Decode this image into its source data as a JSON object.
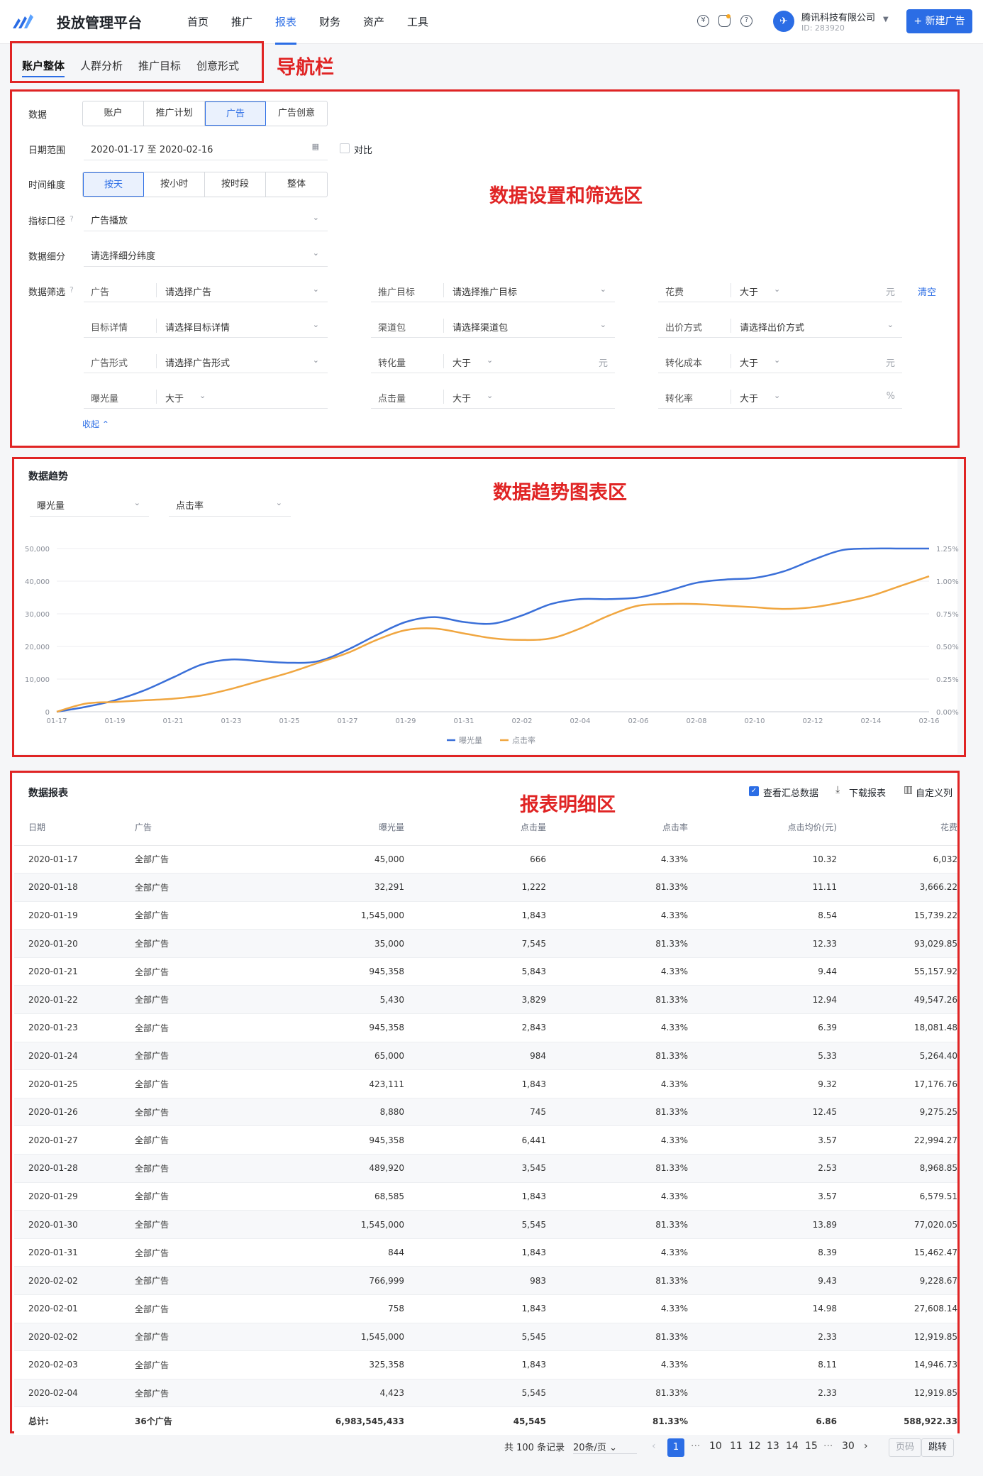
{
  "header": {
    "app_title": "投放管理平台",
    "nav": [
      "首页",
      "推广",
      "报表",
      "财务",
      "资产",
      "工具"
    ],
    "active_nav": "报表",
    "company": "腾讯科技有限公司",
    "company_id": "ID: 283920",
    "new_btn": "+ 新建广告"
  },
  "annotations": {
    "nav": "导航栏",
    "filter": "数据设置和筛选区",
    "chart": "数据趋势图表区",
    "table": "报表明细区"
  },
  "subnav": [
    "账户整体",
    "人群分析",
    "推广目标",
    "创意形式"
  ],
  "filters": {
    "data_label": "数据",
    "data_opts": [
      "账户",
      "推广计划",
      "广告",
      "广告创意"
    ],
    "date_label": "日期范围",
    "date_value": "2020-01-17 至 2020-02-16",
    "compare": "对比",
    "dim_label": "时间维度",
    "dim_opts": [
      "按天",
      "按小时",
      "按时段",
      "整体"
    ],
    "metric_label": "指标口径",
    "metric_value": "广告播放",
    "detail_label": "数据细分",
    "detail_value": "请选择细分纬度",
    "filter_label": "数据筛选",
    "clear": "清空",
    "collapse": "收起",
    "rows": [
      [
        {
          "k": "广告",
          "v": "请选择广告"
        },
        {
          "k": "推广目标",
          "v": "请选择推广目标"
        },
        {
          "k": "花费",
          "v": "大于",
          "u": "元"
        }
      ],
      [
        {
          "k": "目标详情",
          "v": "请选择目标详情"
        },
        {
          "k": "渠道包",
          "v": "请选择渠道包"
        },
        {
          "k": "出价方式",
          "v": "请选择出价方式"
        }
      ],
      [
        {
          "k": "广告形式",
          "v": "请选择广告形式"
        },
        {
          "k": "转化量",
          "v": "大于",
          "u": "元"
        },
        {
          "k": "转化成本",
          "v": "大于",
          "u": "元"
        }
      ],
      [
        {
          "k": "曝光量",
          "v": "大于"
        },
        {
          "k": "点击量",
          "v": "大于"
        },
        {
          "k": "转化率",
          "v": "大于",
          "u": "%"
        }
      ]
    ]
  },
  "trend": {
    "title": "数据趋势",
    "sel1": "曝光量",
    "sel2": "点击率"
  },
  "chart_data": {
    "type": "line",
    "x": [
      "01-17",
      "01-18",
      "01-19",
      "01-20",
      "01-21",
      "01-22",
      "01-23",
      "01-24",
      "01-25",
      "01-26",
      "01-27",
      "01-28",
      "01-29",
      "01-30",
      "01-31",
      "02-01",
      "02-02",
      "02-03",
      "02-04",
      "02-05",
      "02-06",
      "02-07",
      "02-08",
      "02-09",
      "02-10",
      "02-11",
      "02-12",
      "02-13",
      "02-14",
      "02-15",
      "02-16"
    ],
    "xticks": [
      "01-17",
      "01-19",
      "01-21",
      "01-23",
      "01-25",
      "01-27",
      "01-29",
      "01-31",
      "02-02",
      "02-04",
      "02-06",
      "02-08",
      "02-10",
      "02-12",
      "02-14",
      "02-16"
    ],
    "yleft_ticks": [
      "0",
      "10,000",
      "20,000",
      "30,000",
      "40,000",
      "50,000"
    ],
    "ylim_left": [
      0,
      50000
    ],
    "yright_ticks": [
      "0.00%",
      "0.25%",
      "0.50%",
      "0.75%",
      "1.00%",
      "1.25%"
    ],
    "ylim_right": [
      0,
      1.25
    ],
    "series": [
      {
        "name": "曝光量",
        "axis": "left",
        "color": "#3a6fd8",
        "values": [
          0,
          1500,
          3500,
          6500,
          10500,
          14500,
          16000,
          15500,
          15000,
          15500,
          19000,
          23500,
          27500,
          29000,
          27500,
          27000,
          29500,
          33000,
          34500,
          34500,
          35000,
          37000,
          39500,
          40500,
          41000,
          43000,
          46500,
          49500,
          50000,
          50000,
          50000
        ]
      },
      {
        "name": "点击率",
        "axis": "left",
        "color": "#f0a640",
        "values": [
          0,
          2500,
          3000,
          3500,
          4000,
          5000,
          7000,
          9500,
          12000,
          15000,
          18000,
          22000,
          25000,
          25500,
          24000,
          22500,
          22000,
          22500,
          25500,
          29500,
          32500,
          33000,
          33000,
          32500,
          32000,
          31500,
          32000,
          33500,
          35500,
          38500,
          41500
        ]
      }
    ]
  },
  "report": {
    "title": "数据报表",
    "summary": "查看汇总数据",
    "download": "下载报表",
    "custom": "自定义列",
    "columns": [
      "日期",
      "广告",
      "曝光量",
      "点击量",
      "点击率",
      "点击均价(元)",
      "花费"
    ],
    "rows": [
      [
        "2020-01-17",
        "全部广告",
        "45,000",
        "666",
        "4.33%",
        "10.32",
        "6,032"
      ],
      [
        "2020-01-18",
        "全部广告",
        "32,291",
        "1,222",
        "81.33%",
        "11.11",
        "3,666.22"
      ],
      [
        "2020-01-19",
        "全部广告",
        "1,545,000",
        "1,843",
        "4.33%",
        "8.54",
        "15,739.22"
      ],
      [
        "2020-01-20",
        "全部广告",
        "35,000",
        "7,545",
        "81.33%",
        "12.33",
        "93,029.85"
      ],
      [
        "2020-01-21",
        "全部广告",
        "945,358",
        "5,843",
        "4.33%",
        "9.44",
        "55,157.92"
      ],
      [
        "2020-01-22",
        "全部广告",
        "5,430",
        "3,829",
        "81.33%",
        "12.94",
        "49,547.26"
      ],
      [
        "2020-01-23",
        "全部广告",
        "945,358",
        "2,843",
        "4.33%",
        "6.39",
        "18,081.48"
      ],
      [
        "2020-01-24",
        "全部广告",
        "65,000",
        "984",
        "81.33%",
        "5.33",
        "5,264.40"
      ],
      [
        "2020-01-25",
        "全部广告",
        "423,111",
        "1,843",
        "4.33%",
        "9.32",
        "17,176.76"
      ],
      [
        "2020-01-26",
        "全部广告",
        "8,880",
        "745",
        "81.33%",
        "12.45",
        "9,275.25"
      ],
      [
        "2020-01-27",
        "全部广告",
        "945,358",
        "6,441",
        "4.33%",
        "3.57",
        "22,994.27"
      ],
      [
        "2020-01-28",
        "全部广告",
        "489,920",
        "3,545",
        "81.33%",
        "2.53",
        "8,968.85"
      ],
      [
        "2020-01-29",
        "全部广告",
        "68,585",
        "1,843",
        "4.33%",
        "3.57",
        "6,579.51"
      ],
      [
        "2020-01-30",
        "全部广告",
        "1,545,000",
        "5,545",
        "81.33%",
        "13.89",
        "77,020.05"
      ],
      [
        "2020-01-31",
        "全部广告",
        "844",
        "1,843",
        "4.33%",
        "8.39",
        "15,462.47"
      ],
      [
        "2020-02-02",
        "全部广告",
        "766,999",
        "983",
        "81.33%",
        "9.43",
        "9,228.67"
      ],
      [
        "2020-02-01",
        "全部广告",
        "758",
        "1,843",
        "4.33%",
        "14.98",
        "27,608.14"
      ],
      [
        "2020-02-02",
        "全部广告",
        "1,545,000",
        "5,545",
        "81.33%",
        "2.33",
        "12,919.85"
      ],
      [
        "2020-02-03",
        "全部广告",
        "325,358",
        "1,843",
        "4.33%",
        "8.11",
        "14,946.73"
      ],
      [
        "2020-02-04",
        "全部广告",
        "4,423",
        "5,545",
        "81.33%",
        "2.33",
        "12,919.85"
      ]
    ],
    "total": [
      "总计:",
      "36个广告",
      "6,983,545,433",
      "45,545",
      "81.33%",
      "6.86",
      "588,922.33"
    ]
  },
  "pager": {
    "total": "共 100 条记录",
    "size": "20条/页",
    "pages": [
      "1",
      "10",
      "11",
      "12",
      "13",
      "14",
      "15",
      "30"
    ],
    "ellipsis": "···",
    "goto": "页码",
    "jump": "跳转"
  }
}
